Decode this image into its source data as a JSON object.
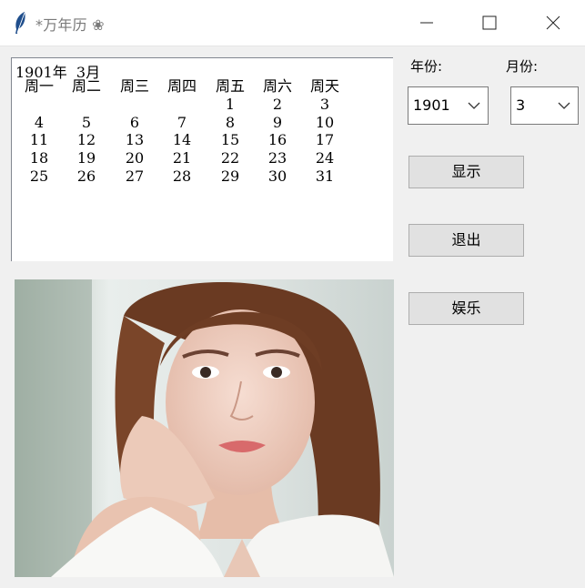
{
  "window": {
    "title": "*万年历 ❀",
    "icon": "feather-icon",
    "controls": [
      "minimize-icon",
      "maximize-icon",
      "close-icon"
    ]
  },
  "calendar": {
    "heading": "1901年  3月",
    "weekdays": [
      "周一",
      "周二",
      "周三",
      "周四",
      "周五",
      "周六",
      "周天"
    ],
    "weeks": [
      [
        "",
        "",
        "",
        "",
        "1",
        "2",
        "3"
      ],
      [
        "4",
        "5",
        "6",
        "7",
        "8",
        "9",
        "10"
      ],
      [
        "11",
        "12",
        "13",
        "14",
        "15",
        "16",
        "17"
      ],
      [
        "18",
        "19",
        "20",
        "21",
        "22",
        "23",
        "24"
      ],
      [
        "25",
        "26",
        "27",
        "28",
        "29",
        "30",
        "31"
      ]
    ]
  },
  "controls": {
    "year_label": "年份:",
    "month_label": "月份:",
    "year_value": "1901",
    "month_value": "3",
    "show_button": "显示",
    "exit_button": "退出",
    "fun_button": "娱乐"
  },
  "colors": {
    "window_bg": "#f0f0f0",
    "titlebar_bg": "#ffffff",
    "button_bg": "#e1e1e1",
    "button_border": "#adadad"
  }
}
